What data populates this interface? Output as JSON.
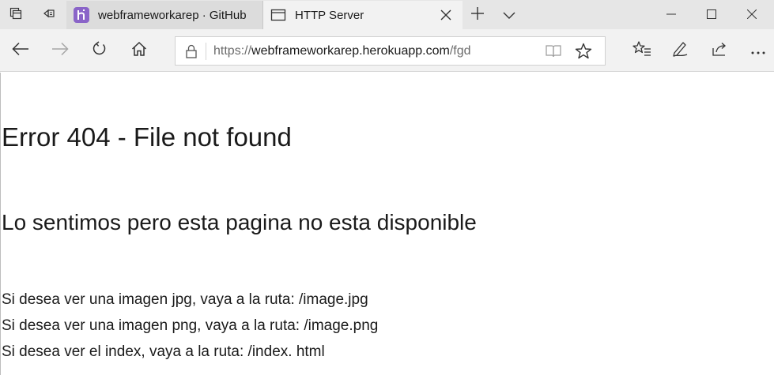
{
  "browser": {
    "tabs": [
      {
        "title": "webframeworkarep · GitHub",
        "active": false,
        "favicon": "heroku-icon"
      },
      {
        "title": "HTTP Server",
        "active": true,
        "favicon": "page-icon"
      }
    ],
    "address": {
      "scheme": "https://",
      "host": "webframeworkarep.herokuapp.com",
      "path": "/fgd"
    },
    "icons": {
      "tab_actions": "tab-actions-icon",
      "set_aside": "set-aside-tabs-icon",
      "new_tab": "plus-icon",
      "tab_menu": "chevron-down-icon",
      "minimize": "minimize-icon",
      "maximize": "maximize-icon",
      "close": "close-icon",
      "back": "back-arrow-icon",
      "forward": "forward-arrow-icon",
      "refresh": "refresh-icon",
      "home": "home-icon",
      "lock": "lock-icon",
      "reading_view": "reading-view-icon",
      "favorite": "star-icon",
      "favorites_hub": "favorites-list-icon",
      "notes": "pen-icon",
      "share": "share-icon",
      "more": "more-icon"
    },
    "colors": {
      "tabstrip_bg": "#e6e6e6",
      "active_tab_bg": "#f2f2f2",
      "heroku_purple": "#8a64c8"
    }
  },
  "page": {
    "heading": "Error 404 - File not found",
    "subheading": "Lo sentimos pero esta pagina no esta disponible",
    "lines": [
      "Si desea ver una imagen jpg, vaya a la ruta: /image.jpg",
      "Si desea ver una imagen png, vaya a la ruta: /image.png",
      "Si desea ver el index, vaya a la ruta: /index. html"
    ]
  }
}
